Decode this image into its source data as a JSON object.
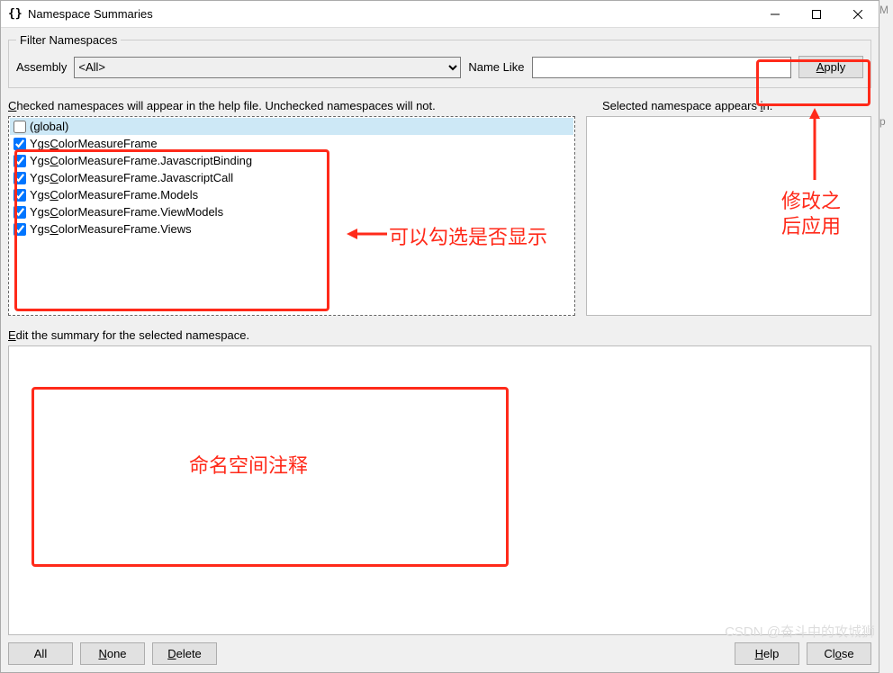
{
  "window": {
    "title": "Namespace Summaries"
  },
  "filter": {
    "legend": "Filter Namespaces",
    "assembly_label": "Assembly",
    "assembly_value": "<All>",
    "namelike_label": "Name Like",
    "namelike_value": "",
    "apply_label": "Apply"
  },
  "list_header_left": "Checked namespaces will appear in the help file.  Unchecked namespaces will not.",
  "list_header_right": "Selected namespace appears in:",
  "namespaces": [
    {
      "checked": false,
      "label": "(global)",
      "selected": true
    },
    {
      "checked": true,
      "label": "YgsColorMeasureFrame"
    },
    {
      "checked": true,
      "label": "YgsColorMeasureFrame.JavascriptBinding"
    },
    {
      "checked": true,
      "label": "YgsColorMeasureFrame.JavascriptCall"
    },
    {
      "checked": true,
      "label": "YgsColorMeasureFrame.Models"
    },
    {
      "checked": true,
      "label": "YgsColorMeasureFrame.ViewModels"
    },
    {
      "checked": true,
      "label": "YgsColorMeasureFrame.Views"
    }
  ],
  "edit_label": "Edit the summary for the selected namespace.",
  "buttons": {
    "all": "All",
    "none": "None",
    "delete": "Delete",
    "help": "Help",
    "close": "Close"
  },
  "annotations": {
    "checklist_note": "可以勾选是否显示",
    "apply_note_line1": "修改之",
    "apply_note_line2": "后应用",
    "editor_note": "命名空间注释"
  },
  "watermark": "CSDN @奋斗中的攻城狮",
  "edge_letters": [
    "M",
    "p"
  ]
}
